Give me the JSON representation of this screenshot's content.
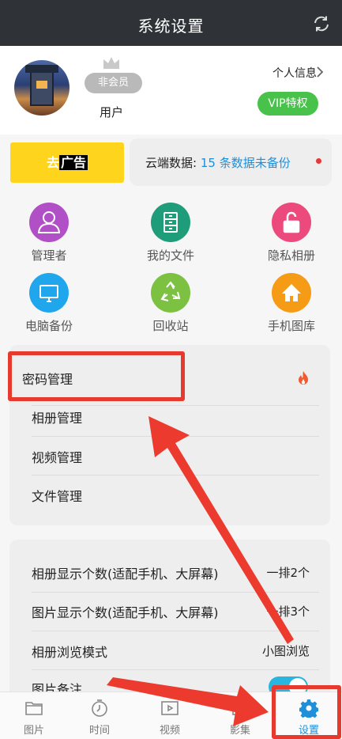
{
  "header": {
    "title": "系统设置",
    "refresh_icon": "refresh-icon"
  },
  "profile": {
    "badge": "非会员",
    "username": "用户",
    "personal_info": "个人信息",
    "vip": "VIP特权"
  },
  "ad": {
    "prefix": "去",
    "highlight": "广告"
  },
  "cloud": {
    "label": "云端数据:",
    "status": "15 条数据未备份"
  },
  "features": [
    {
      "label": "管理者",
      "icon": "user-icon",
      "color": "#b14fc6"
    },
    {
      "label": "我的文件",
      "icon": "file-cabinet-icon",
      "color": "#1f9d7a"
    },
    {
      "label": "隐私相册",
      "icon": "unlock-icon",
      "color": "#ec4a7c"
    },
    {
      "label": "电脑备份",
      "icon": "monitor-icon",
      "color": "#1fa6ec"
    },
    {
      "label": "回收站",
      "icon": "recycle-icon",
      "color": "#7cc142"
    },
    {
      "label": "手机图库",
      "icon": "home-icon",
      "color": "#f59b15"
    }
  ],
  "manage_menu": [
    {
      "label": "密码管理"
    },
    {
      "label": "相册管理"
    },
    {
      "label": "视频管理"
    },
    {
      "label": "文件管理"
    }
  ],
  "settings_menu": [
    {
      "label": "相册显示个数(适配手机、大屏幕)",
      "value": "一排2个"
    },
    {
      "label": "图片显示个数(适配手机、大屏幕)",
      "value": "一排3个"
    },
    {
      "label": "相册浏览模式",
      "value": "小图浏览"
    },
    {
      "label": "图片备注",
      "value": ""
    }
  ],
  "bottom_nav": [
    {
      "label": "图片",
      "icon": "folder-icon"
    },
    {
      "label": "时间",
      "icon": "clock-icon"
    },
    {
      "label": "视频",
      "icon": "video-icon"
    },
    {
      "label": "影集",
      "icon": "album-icon"
    },
    {
      "label": "设置",
      "icon": "gear-icon",
      "active": true
    }
  ],
  "colors": {
    "accent": "#1e8fd8",
    "vip": "#48c24a",
    "annotation": "#e53a2d",
    "topbar": "#2f3338"
  }
}
